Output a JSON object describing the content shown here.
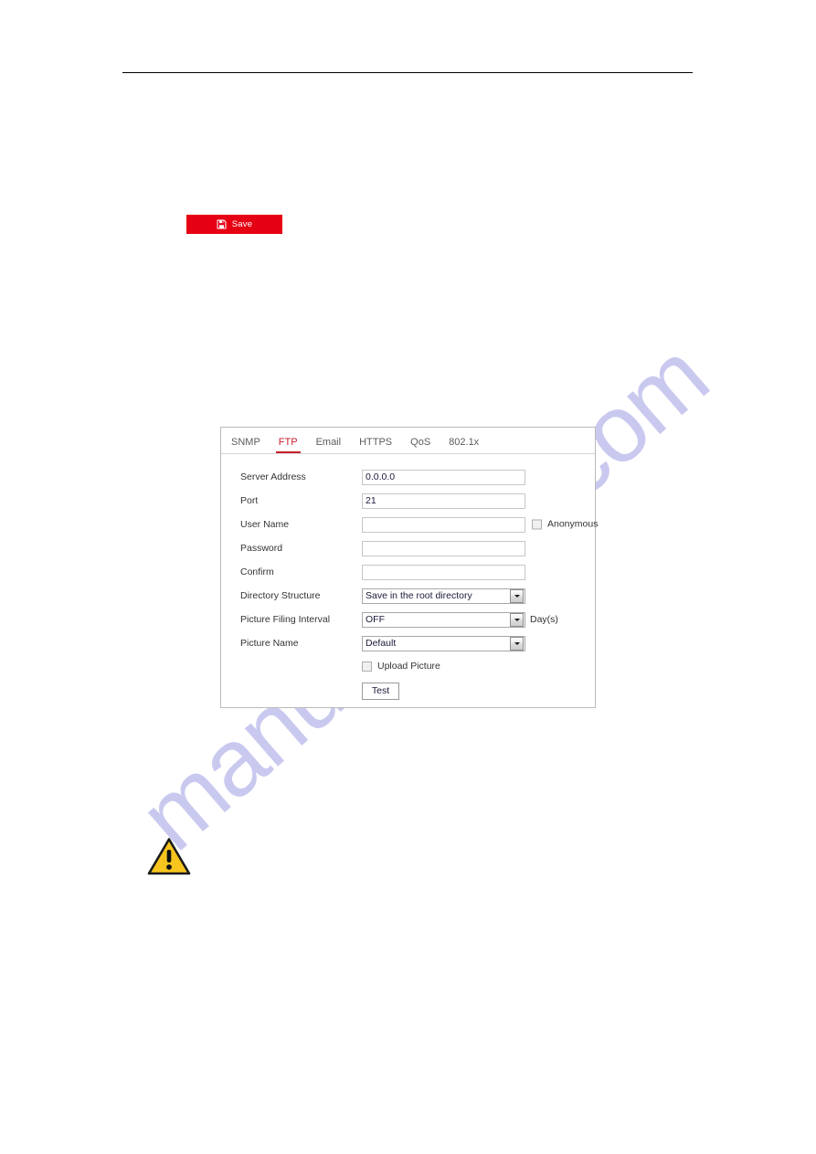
{
  "document": {
    "watermark_text": "manualshive.com",
    "watermark_color": "#c5c5ef",
    "header_rule": true
  },
  "toolbar": {
    "save_label": "Save",
    "save_icon": "floppy-disk-save-icon",
    "save_bg_color": "#e60013"
  },
  "panel": {
    "accent_color": "#c8202c",
    "tabs": [
      {
        "label": "SNMP",
        "active": false
      },
      {
        "label": "FTP",
        "active": true
      },
      {
        "label": "Email",
        "active": false
      },
      {
        "label": "HTTPS",
        "active": false
      },
      {
        "label": "QoS",
        "active": false
      },
      {
        "label": "802.1x",
        "active": false
      }
    ],
    "fields": {
      "server_address": {
        "label": "Server Address",
        "value": "0.0.0.0"
      },
      "port": {
        "label": "Port",
        "value": "21"
      },
      "user_name": {
        "label": "User Name",
        "value": ""
      },
      "password": {
        "label": "Password",
        "value": ""
      },
      "confirm": {
        "label": "Confirm",
        "value": ""
      },
      "directory_structure": {
        "label": "Directory Structure",
        "value": "Save in the root directory"
      },
      "picture_filing_interval": {
        "label": "Picture Filing Interval",
        "value": "OFF",
        "suffix": "Day(s)"
      },
      "picture_name": {
        "label": "Picture Name",
        "value": "Default"
      }
    },
    "checkboxes": {
      "anonymous": {
        "label": "Anonymous",
        "checked": false
      },
      "upload_picture": {
        "label": "Upload Picture",
        "checked": false
      }
    },
    "buttons": {
      "test": "Test"
    }
  },
  "notice": {
    "icon": "warning-triangle-icon",
    "icon_fill": "#f7c51e"
  }
}
